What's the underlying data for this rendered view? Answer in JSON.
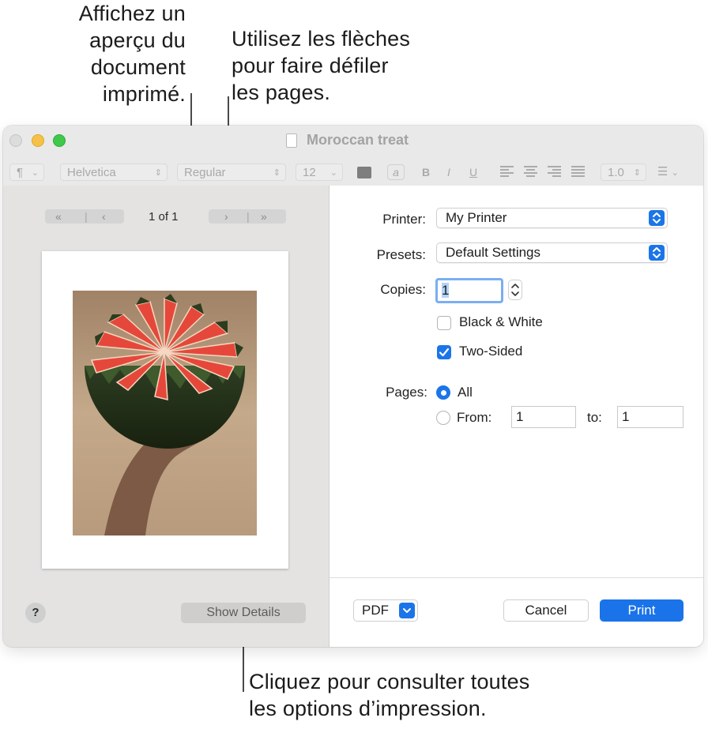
{
  "callouts": {
    "preview": "Affichez un\naperçu du\ndocument\nimprimé.",
    "arrows": "Utilisez les flèches\npour faire défiler\nles pages.",
    "details": "Cliquez pour consulter toutes\nles options d’impression."
  },
  "window": {
    "title": "Moroccan treat",
    "toolbar": {
      "paragraph": "¶",
      "font": "Helvetica",
      "style": "Regular",
      "size": "12",
      "highlight": "a",
      "bold": "B",
      "italic": "I",
      "underline": "U",
      "spacing": "1.0",
      "list": "☰"
    }
  },
  "print": {
    "preview": {
      "back": "<<   |   <",
      "forward": ">   |   >>",
      "page_indicator": "1 of 1"
    },
    "help_label": "?",
    "show_details_label": "Show Details",
    "printer_label": "Printer:",
    "printer_value": "My Printer",
    "presets_label": "Presets:",
    "presets_value": "Default Settings",
    "copies_label": "Copies:",
    "copies_value": "1",
    "black_white_label": "Black & White",
    "black_white_checked": false,
    "two_sided_label": "Two-Sided",
    "two_sided_checked": true,
    "pages_label": "Pages:",
    "pages_all_label": "All",
    "pages_from_label": "From:",
    "pages_from_value": "1",
    "pages_to_label": "to:",
    "pages_to_value": "1",
    "pdf_label": "PDF",
    "cancel_label": "Cancel",
    "print_label": "Print"
  },
  "colors": {
    "accent": "#1a73e8",
    "window_bg": "#f3f3f3",
    "preview_pane": "#e4e3e2"
  }
}
